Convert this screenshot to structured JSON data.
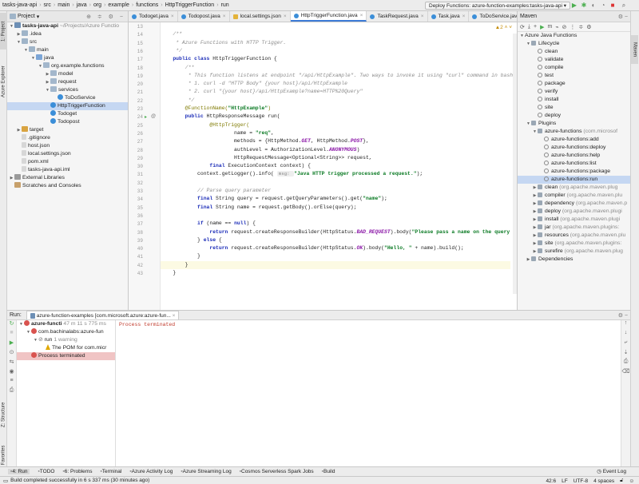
{
  "breadcrumbs": [
    "tasks-java-api",
    "src",
    "main",
    "java",
    "org",
    "example",
    "functions",
    "HttpTriggerFunction",
    "run"
  ],
  "run_config": "Deploy Functions: azure-function-examples:tasks-java-api",
  "left_strip": {
    "project_tab": "1: Project",
    "azure_tab": "Azure Explorer",
    "structure_tab": "Z: Structure",
    "favorites_tab": "2: Favorites"
  },
  "right_strip": {
    "maven_tab": "Maven"
  },
  "project": {
    "title": "Project",
    "rows": [
      {
        "name": "tasks-java-api",
        "extra": "~/Projects/Azure Functio",
        "level": 0,
        "icon": "java-mod",
        "expanded": true,
        "bold": true
      },
      {
        "name": ".idea",
        "level": 1,
        "icon": "folder",
        "collapsed": true
      },
      {
        "name": "src",
        "level": 1,
        "icon": "folder",
        "expanded": true
      },
      {
        "name": "main",
        "level": 2,
        "icon": "folder",
        "expanded": true
      },
      {
        "name": "java",
        "level": 3,
        "icon": "folder-src",
        "expanded": true
      },
      {
        "name": "org.example.functions",
        "level": 4,
        "icon": "folder-pkg",
        "expanded": true
      },
      {
        "name": "model",
        "level": 5,
        "icon": "folder-pkg",
        "collapsed": true
      },
      {
        "name": "request",
        "level": 5,
        "icon": "folder-pkg",
        "collapsed": true
      },
      {
        "name": "services",
        "level": 5,
        "icon": "folder-pkg",
        "expanded": true
      },
      {
        "name": "ToDoService",
        "level": 6,
        "icon": "class"
      },
      {
        "name": "HttpTriggerFunction",
        "level": 5,
        "icon": "class",
        "selected": true
      },
      {
        "name": "Todoget",
        "level": 5,
        "icon": "class"
      },
      {
        "name": "Todopost",
        "level": 5,
        "icon": "class"
      },
      {
        "name": "target",
        "level": 1,
        "icon": "folder-target",
        "collapsed": true
      },
      {
        "name": ".gitignore",
        "level": 1,
        "icon": "file"
      },
      {
        "name": "host.json",
        "level": 1,
        "icon": "file"
      },
      {
        "name": "local.settings.json",
        "level": 1,
        "icon": "file"
      },
      {
        "name": "pom.xml",
        "level": 1,
        "icon": "file"
      },
      {
        "name": "tasks-java-api.iml",
        "level": 1,
        "icon": "file"
      },
      {
        "name": "External Libraries",
        "level": 0,
        "icon": "lib",
        "collapsed": true
      },
      {
        "name": "Scratches and Consoles",
        "level": 0,
        "icon": "scratch"
      }
    ]
  },
  "tabs": [
    {
      "label": "Todoget.java",
      "type": "class"
    },
    {
      "label": "Todopost.java",
      "type": "class"
    },
    {
      "label": "local.settings.json",
      "type": "json"
    },
    {
      "label": "HttpTriggerFunction.java",
      "type": "class",
      "active": true
    },
    {
      "label": "TaskRequest.java",
      "type": "class"
    },
    {
      "label": "Task.java",
      "type": "class"
    },
    {
      "label": "ToDoService.java",
      "type": "class"
    }
  ],
  "editor": {
    "warnings": "2",
    "line_numbers": [
      "13",
      "14",
      "15",
      "16",
      "17",
      "18",
      "19",
      "20",
      "21",
      "22",
      "23",
      "24",
      "25",
      "26",
      "27",
      "28",
      "29",
      "30",
      "31",
      "32",
      "33",
      "34",
      "35",
      "36",
      "37",
      "38",
      "39",
      "40",
      "41",
      "42",
      "43"
    ],
    "lines": [
      [],
      [
        {
          "t": "    /**",
          "c": "cm"
        }
      ],
      [
        {
          "t": "     * Azure Functions with HTTP Trigger.",
          "c": "cm"
        }
      ],
      [
        {
          "t": "     */",
          "c": "cm"
        }
      ],
      [
        {
          "t": "    public class ",
          "c": "kw"
        },
        {
          "t": "HttpTriggerFunction {"
        }
      ],
      [
        {
          "t": "        /**",
          "c": "cm"
        }
      ],
      [
        {
          "t": "         * This function listens at endpoint \"/api/HttpExample\". Two ways to invoke it using \"curl\" command in bash:",
          "c": "cm"
        }
      ],
      [
        {
          "t": "         * 1. curl -d \"HTTP Body\" {your host}/api/HttpExample",
          "c": "cm"
        }
      ],
      [
        {
          "t": "         * 2. curl \"{your host}/api/HttpExample?name=HTTP%20Query\"",
          "c": "cm"
        }
      ],
      [
        {
          "t": "         */",
          "c": "cm"
        }
      ],
      [
        {
          "t": "        @FunctionName(",
          "c": "an"
        },
        {
          "t": "\"HttpExample\"",
          "c": "st"
        },
        {
          "t": ")",
          "c": "an"
        }
      ],
      [
        {
          "t": "        public ",
          "c": "kw"
        },
        {
          "t": "HttpResponseMessage run("
        }
      ],
      [
        {
          "t": "                "
        },
        {
          "t": "@HttpTrigger(",
          "c": "an"
        }
      ],
      [
        {
          "t": "                        name = "
        },
        {
          "t": "\"req\"",
          "c": "st"
        },
        {
          "t": ","
        }
      ],
      [
        {
          "t": "                        methods = {HttpMethod."
        },
        {
          "t": "GET",
          "c": "cst"
        },
        {
          "t": ", HttpMethod."
        },
        {
          "t": "POST",
          "c": "cst"
        },
        {
          "t": "},"
        }
      ],
      [
        {
          "t": "                        authLevel = AuthorizationLevel."
        },
        {
          "t": "ANONYMOUS",
          "c": "cst"
        },
        {
          "t": ")"
        }
      ],
      [
        {
          "t": "                        HttpRequestMessage<Optional<String>> request,"
        }
      ],
      [
        {
          "t": "                "
        },
        {
          "t": "final ",
          "c": "kw"
        },
        {
          "t": "ExecutionContext context) {"
        }
      ],
      [
        {
          "t": "            context.getLogger().info( "
        },
        {
          "t": "msg: ",
          "c": "hint"
        },
        {
          "t": "\"Java HTTP trigger processed a request.\"",
          "c": "st"
        },
        {
          "t": ");"
        }
      ],
      [],
      [
        {
          "t": "            // Parse query parameter",
          "c": "cm"
        }
      ],
      [
        {
          "t": "            "
        },
        {
          "t": "final ",
          "c": "kw"
        },
        {
          "t": "String query = request.getQueryParameters().get("
        },
        {
          "t": "\"name\"",
          "c": "st"
        },
        {
          "t": ");"
        }
      ],
      [
        {
          "t": "            "
        },
        {
          "t": "final ",
          "c": "kw"
        },
        {
          "t": "String name = request.getBody().orElse(query);"
        }
      ],
      [],
      [
        {
          "t": "            "
        },
        {
          "t": "if ",
          "c": "kw"
        },
        {
          "t": "(name == "
        },
        {
          "t": "null",
          "c": "kw"
        },
        {
          "t": ") {"
        }
      ],
      [
        {
          "t": "                "
        },
        {
          "t": "return ",
          "c": "kw"
        },
        {
          "t": "request.createResponseBuilder(HttpStatus."
        },
        {
          "t": "BAD_REQUEST",
          "c": "cst"
        },
        {
          "t": ").body("
        },
        {
          "t": "\"Please pass a name on the query str",
          "c": "st"
        }
      ],
      [
        {
          "t": "            } "
        },
        {
          "t": "else ",
          "c": "kw"
        },
        {
          "t": "{"
        }
      ],
      [
        {
          "t": "                "
        },
        {
          "t": "return ",
          "c": "kw"
        },
        {
          "t": "request.createResponseBuilder(HttpStatus."
        },
        {
          "t": "OK",
          "c": "cst"
        },
        {
          "t": ").body("
        },
        {
          "t": "\"Hello, \"",
          "c": "st"
        },
        {
          "t": " + name).build();"
        }
      ],
      [
        {
          "t": "            }"
        }
      ],
      [
        {
          "t": "        }"
        }
      ],
      [
        {
          "t": "    }"
        }
      ]
    ],
    "current_line_index": 29
  },
  "maven": {
    "title": "Maven",
    "rows": [
      {
        "name": "Azure Java Functions",
        "level": 0,
        "arrow": "down"
      },
      {
        "name": "Lifecycle",
        "level": 1,
        "arrow": "down",
        "icon": "folder"
      },
      {
        "name": "clean",
        "level": 2,
        "icon": "gear"
      },
      {
        "name": "validate",
        "level": 2,
        "icon": "gear"
      },
      {
        "name": "compile",
        "level": 2,
        "icon": "gear"
      },
      {
        "name": "test",
        "level": 2,
        "icon": "gear"
      },
      {
        "name": "package",
        "level": 2,
        "icon": "gear"
      },
      {
        "name": "verify",
        "level": 2,
        "icon": "gear"
      },
      {
        "name": "install",
        "level": 2,
        "icon": "gear"
      },
      {
        "name": "site",
        "level": 2,
        "icon": "gear"
      },
      {
        "name": "deploy",
        "level": 2,
        "icon": "gear"
      },
      {
        "name": "Plugins",
        "level": 1,
        "arrow": "down",
        "icon": "folder"
      },
      {
        "name": "azure-functions",
        "extra": "(com.microsof",
        "level": 2,
        "arrow": "down",
        "icon": "plugin"
      },
      {
        "name": "azure-functions:add",
        "level": 3,
        "icon": "gear"
      },
      {
        "name": "azure-functions:deploy",
        "level": 3,
        "icon": "gear"
      },
      {
        "name": "azure-functions:help",
        "level": 3,
        "icon": "gear"
      },
      {
        "name": "azure-functions:list",
        "level": 3,
        "icon": "gear"
      },
      {
        "name": "azure-functions:package",
        "level": 3,
        "icon": "gear"
      },
      {
        "name": "azure-functions:run",
        "level": 3,
        "icon": "gear",
        "selected": true
      },
      {
        "name": "clean",
        "extra": "(org.apache.maven.plug",
        "level": 2,
        "arrow": "right",
        "icon": "plugin"
      },
      {
        "name": "compiler",
        "extra": "(org.apache.maven.plu",
        "level": 2,
        "arrow": "right",
        "icon": "plugin"
      },
      {
        "name": "dependency",
        "extra": "(org.apache.maven.p",
        "level": 2,
        "arrow": "right",
        "icon": "plugin"
      },
      {
        "name": "deploy",
        "extra": "(org.apache.maven.plugi",
        "level": 2,
        "arrow": "right",
        "icon": "plugin"
      },
      {
        "name": "install",
        "extra": "(org.apache.maven.plugi",
        "level": 2,
        "arrow": "right",
        "icon": "plugin"
      },
      {
        "name": "jar",
        "extra": "(org.apache.maven.plugins:",
        "level": 2,
        "arrow": "right",
        "icon": "plugin"
      },
      {
        "name": "resources",
        "extra": "(org.apache.maven.plu",
        "level": 2,
        "arrow": "right",
        "icon": "plugin"
      },
      {
        "name": "site",
        "extra": "(org.apache.maven.plugins:",
        "level": 2,
        "arrow": "right",
        "icon": "plugin"
      },
      {
        "name": "surefire",
        "extra": "(org.apache.maven.plug",
        "level": 2,
        "arrow": "right",
        "icon": "plugin"
      },
      {
        "name": "Dependencies",
        "level": 1,
        "arrow": "right",
        "icon": "folder"
      }
    ]
  },
  "run_panel": {
    "label": "Run:",
    "tab": "azure-function-examples [com.microsoft.azure:azure-fun...",
    "tree": [
      {
        "name": "azure-functi",
        "extra": "47 m 11 s 775 ms",
        "level": 0,
        "icon": "err",
        "bold": true
      },
      {
        "name": "com.bachinalabs:azure-fun",
        "level": 1,
        "icon": "err"
      },
      {
        "name": "run",
        "extra": "1 warning",
        "level": 2,
        "icon": "run"
      },
      {
        "name": "The POM for com.micr",
        "level": 3,
        "icon": "warn"
      },
      {
        "name": "Process terminated",
        "level": 1,
        "icon": "err",
        "selected": true
      }
    ],
    "console": "Process terminated"
  },
  "bottom_tabs": [
    {
      "label": "4: Run",
      "active": true
    },
    {
      "label": "TODO"
    },
    {
      "label": "6: Problems"
    },
    {
      "label": "Terminal"
    },
    {
      "label": "Azure Activity Log"
    },
    {
      "label": "Azure Streaming Log"
    },
    {
      "label": "Cosmos Serverless Spark Jobs"
    },
    {
      "label": "Build"
    }
  ],
  "event_log": "Event Log",
  "status": {
    "message": "Build completed successfully in 6 s 337 ms (30 minutes ago)",
    "position": "42:6",
    "line_sep": "LF",
    "encoding": "UTF-8",
    "indent": "4 spaces"
  },
  "colors": {
    "accent": "#3d7bd7",
    "selection": "#c5d7f2",
    "error": "#d9534f",
    "run_green": "#4caf50"
  }
}
